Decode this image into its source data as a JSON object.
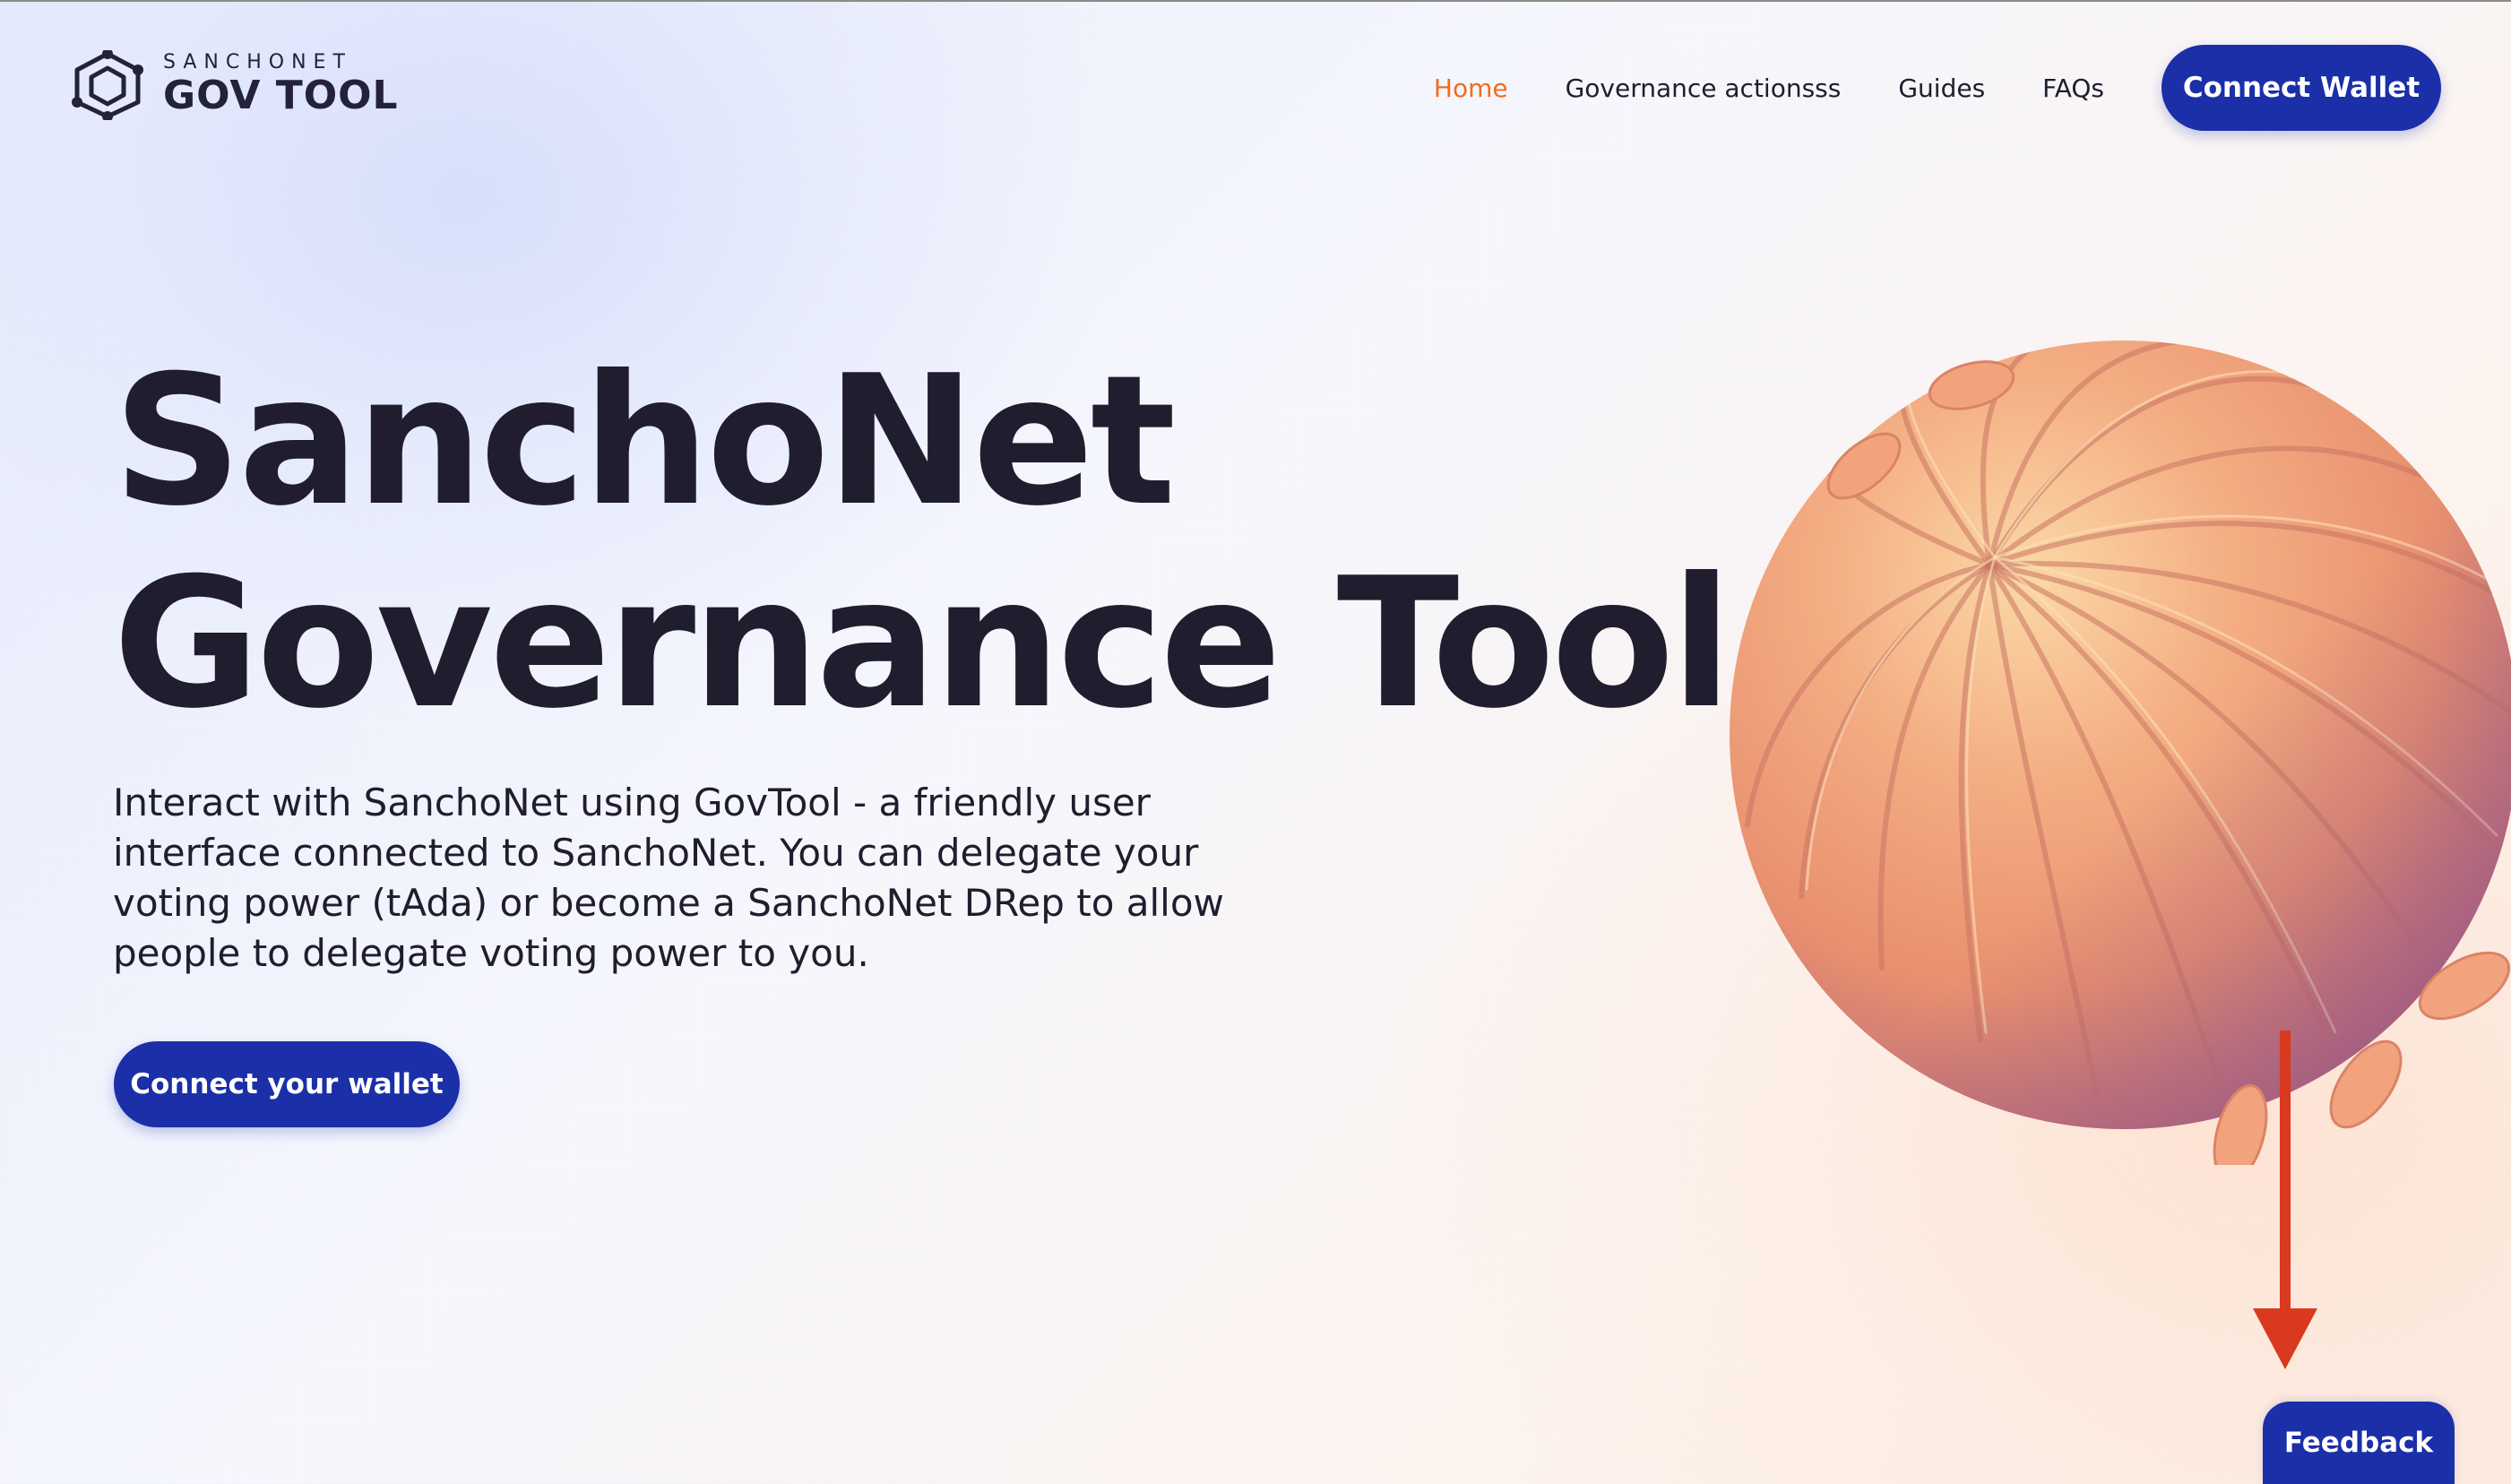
{
  "header": {
    "logo": {
      "subtitle": "SANCHONET",
      "title": "GOV TOOL",
      "icon": "hexagon-network-logo-icon"
    },
    "nav": [
      {
        "label": "Home",
        "active": true
      },
      {
        "label": "Governance actionsss",
        "active": false
      },
      {
        "label": "Guides",
        "active": false
      },
      {
        "label": "FAQs",
        "active": false
      }
    ],
    "connect_button": "Connect Wallet"
  },
  "hero": {
    "title_line1": "SanchoNet",
    "title_line2": "Governance Tool",
    "description": "Interact with SanchoNet using GovTool - a friendly user interface connected to SanchoNet. You can delegate your voting power (tAda) or become a SanchoNet DRep to allow people to delegate voting power to you.",
    "cta_button": "Connect your wallet",
    "illustration": "orange-striped-sphere"
  },
  "annotation": {
    "type": "arrow-down",
    "color": "#d9391f"
  },
  "feedback_button": "Feedback",
  "colors": {
    "primary": "#1a2fa8",
    "active_nav": "#f26b21",
    "text": "#1f1d2e"
  }
}
